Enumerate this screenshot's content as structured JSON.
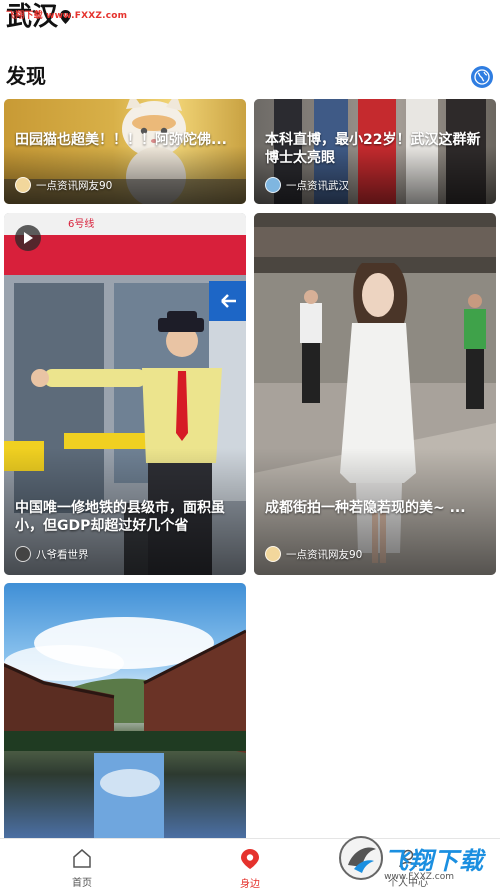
{
  "watermark": {
    "top_text": "飞翔下载 www.FXXZ.com",
    "logo_text": "飞翔下载",
    "logo_url": "www.FXXZ.com"
  },
  "header": {
    "city": "武汉",
    "section_title": "发现"
  },
  "cards": [
    {
      "title": "田园猫也超美！！！！阿弥陀佛...",
      "source": "一点资讯网友90"
    },
    {
      "title": "本科直博，最小22岁！武汉这群新博士太亮眼",
      "source": "一点资讯武汉"
    },
    {
      "title": "中国唯一修地铁的县级市，面积虽小，但GDP却超过好几个省",
      "source": "八爷看世界",
      "video": true
    },
    {
      "title": "成都街拍一种若隐若现的美~ ...",
      "source": "一点资讯网友90"
    },
    {
      "title": "",
      "source": ""
    }
  ],
  "tabbar": {
    "items": [
      {
        "label": "首页",
        "icon": "home-icon"
      },
      {
        "label": "身边",
        "icon": "location-pin-icon",
        "active": true
      },
      {
        "label": "个人中心",
        "icon": "profile-icon"
      }
    ]
  },
  "colors": {
    "accent": "#e5322d",
    "globe": "#2f7de1"
  }
}
